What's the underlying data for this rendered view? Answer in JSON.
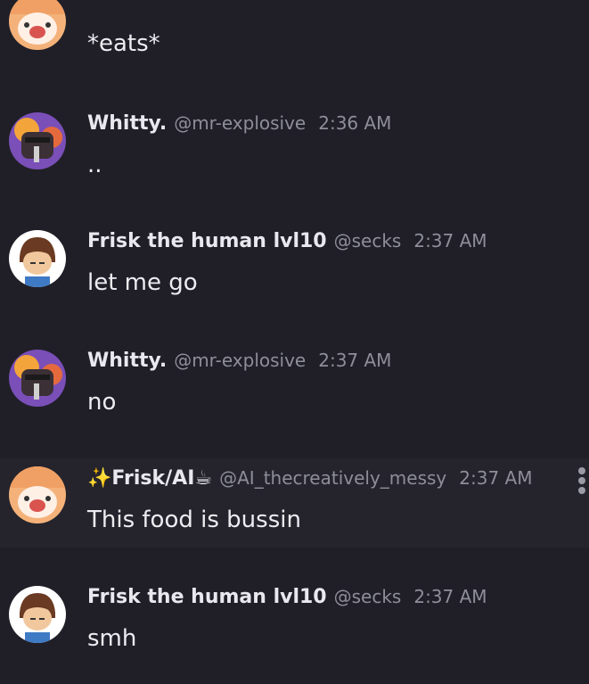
{
  "messages": [
    {
      "text": "*eats*"
    },
    {
      "name": "Whitty.",
      "handle": "@mr-explosive",
      "time": "2:36 AM",
      "text": ".."
    },
    {
      "name": "Frisk the human lvl10",
      "handle": "@secks",
      "time": "2:37 AM",
      "text": "let me go"
    },
    {
      "name": "Whitty.",
      "handle": "@mr-explosive",
      "time": "2:37 AM",
      "text": "no"
    },
    {
      "name": "✨Frisk/AI☕",
      "handle": "@AI_thecreatively_messy",
      "time": "2:37 AM",
      "text": "This food is bussin"
    },
    {
      "name": "Frisk the human lvl10",
      "handle": "@secks",
      "time": "2:37 AM",
      "text": "smh"
    }
  ],
  "icons": {
    "more": "vertical-ellipsis-icon"
  },
  "colors": {
    "background": "#201f28",
    "name": "#e8e8ee",
    "meta": "#8e8e99",
    "text": "#ececf1",
    "accent_purple": "#8b5fd1"
  }
}
